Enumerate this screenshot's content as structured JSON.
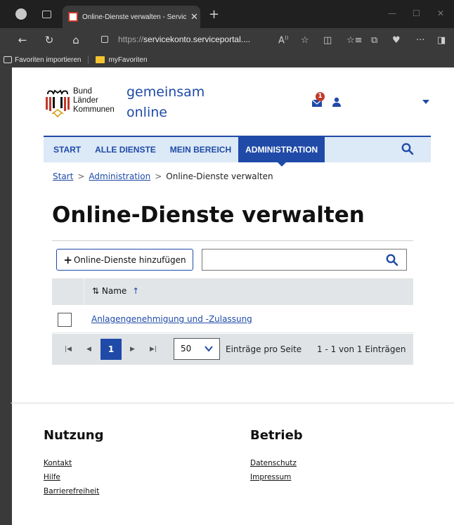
{
  "browser": {
    "tab_title": "Online-Dienste verwalten - Servic",
    "url_prefix": "https://",
    "url_host": "servicekonto.serviceportal....",
    "favorites": [
      "Favoriten importieren",
      "myFavoriten"
    ]
  },
  "header": {
    "logo_text": [
      "Bund",
      "Länder",
      "Kommunen"
    ],
    "brand_line1": "gemeinsam",
    "brand_line2": "online",
    "notification_count": "1"
  },
  "nav": {
    "items": [
      "START",
      "ALLE DIENSTE",
      "MEIN BEREICH",
      "ADMINISTRATION"
    ],
    "active": "ADMINISTRATION"
  },
  "breadcrumb": {
    "home": "Start",
    "section": "Administration",
    "current": "Online-Dienste verwalten",
    "separator": ">"
  },
  "page": {
    "title": "Online-Dienste verwalten",
    "add_button": "Online-Dienste hinzufügen",
    "search_placeholder": ""
  },
  "table": {
    "header_name": "Name",
    "rows": [
      {
        "name": "Anlagengenehmigung und -Zulassung"
      }
    ]
  },
  "pagination": {
    "current_page": "1",
    "per_page": "50",
    "per_page_label": "Einträge pro Seite",
    "count_label": "1 - 1 von 1 Einträgen"
  },
  "footer": {
    "col1_title": "Nutzung",
    "col1_links": [
      "Kontakt",
      "Hilfe",
      "Barrierefreiheit"
    ],
    "col2_title": "Betrieb",
    "col2_links": [
      "Datenschutz",
      "Impressum"
    ]
  },
  "colors": {
    "brand_blue": "#1f4aa8",
    "nav_bg": "#dce9f6",
    "alert_red": "#c0392b"
  }
}
